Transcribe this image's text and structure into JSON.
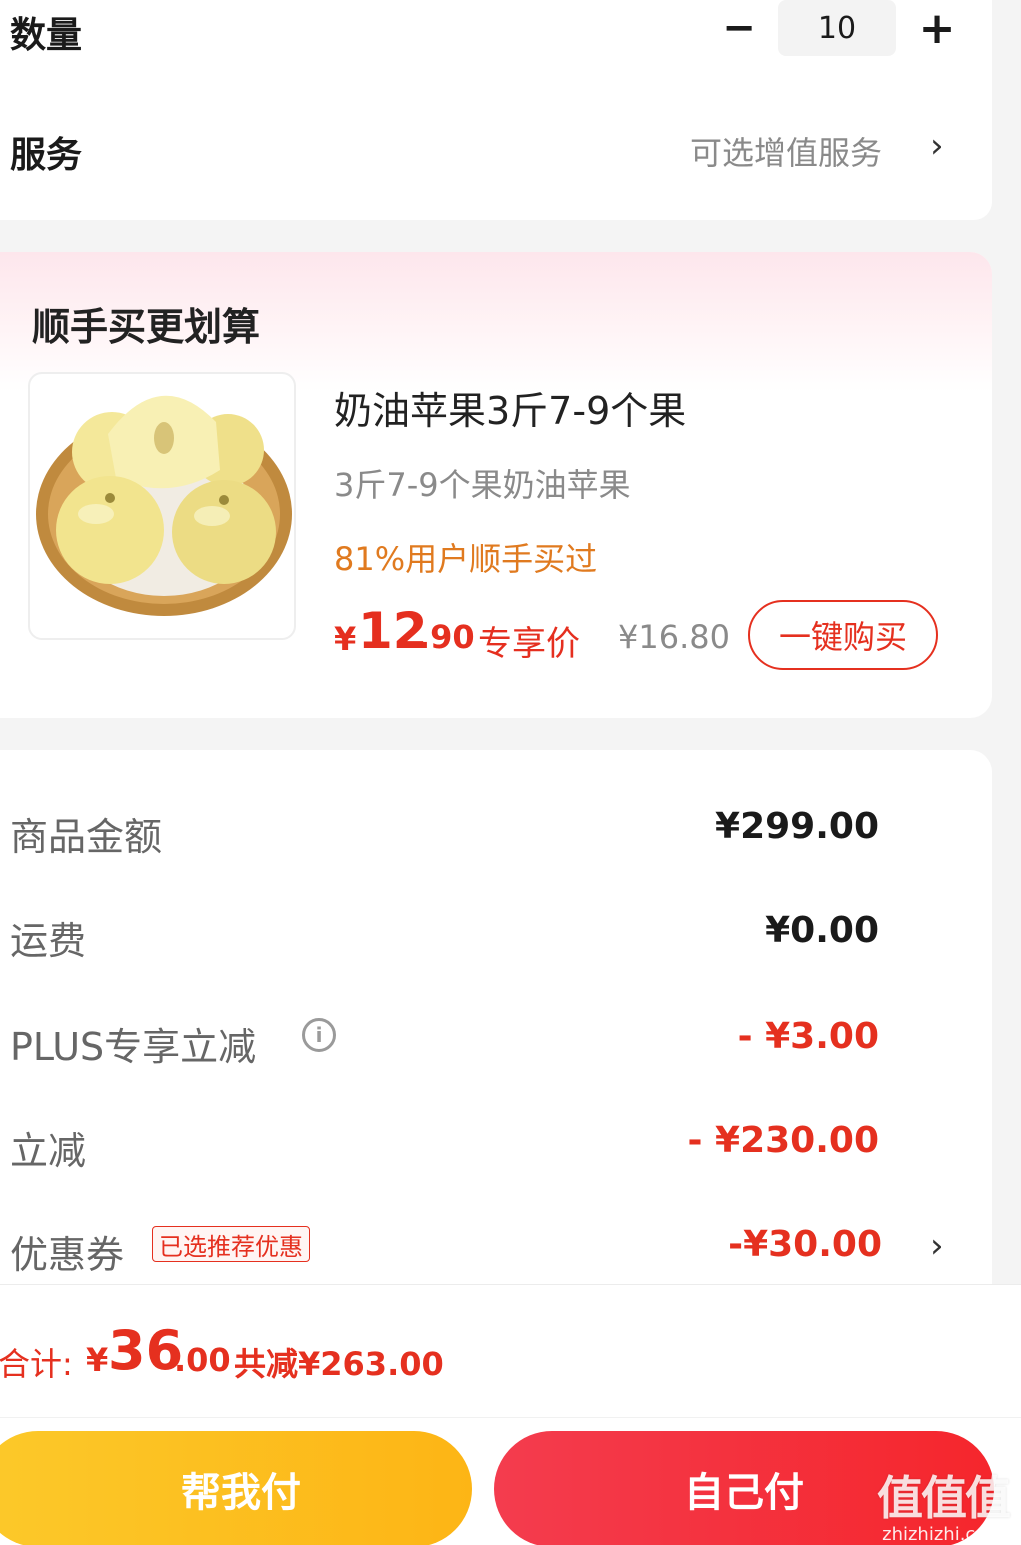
{
  "quantity": {
    "label": "数量",
    "value": "10",
    "minus": "−",
    "plus": "+"
  },
  "service": {
    "label": "服务",
    "value": "可选增值服务",
    "arrow": "›"
  },
  "upsell": {
    "title": "顺手买更划算",
    "product": {
      "name": "奶油苹果3斤7-9个果",
      "subtitle": "3斤7-9个果奶油苹果",
      "note": "81%用户顺手买过",
      "price_symbol": "¥",
      "price_int": "12",
      "price_dec": ".90",
      "price_tag": "专享价",
      "original_price": "¥16.80",
      "buy_button": "一键购买"
    }
  },
  "summary": {
    "goods_amount": {
      "label": "商品金额",
      "value": "¥299.00"
    },
    "shipping": {
      "label": "运费",
      "value": "¥0.00"
    },
    "plus_discount": {
      "label": "PLUS专享立减",
      "value": "- ¥3.00",
      "info_icon": "i"
    },
    "instant_discount": {
      "label": "立减",
      "value": "- ¥230.00"
    },
    "coupon": {
      "label": "优惠券",
      "badge": "已选推荐优惠",
      "value": "-¥30.00",
      "arrow": "›"
    }
  },
  "footer": {
    "total_label": "合计:",
    "total_symbol": "¥",
    "total_int": "36",
    "total_dec": ".00",
    "total_saved": "共减¥263.00",
    "help_pay": "帮我付",
    "self_pay": "自己付"
  },
  "watermark": {
    "big": "值值值",
    "small": "zhizhizhi.com"
  },
  "colors": {
    "accent_red": "#e5301f",
    "orange_note": "#e07a1f",
    "help_pay_yellow": "#fdb515",
    "self_pay_red": "#f5262c"
  }
}
